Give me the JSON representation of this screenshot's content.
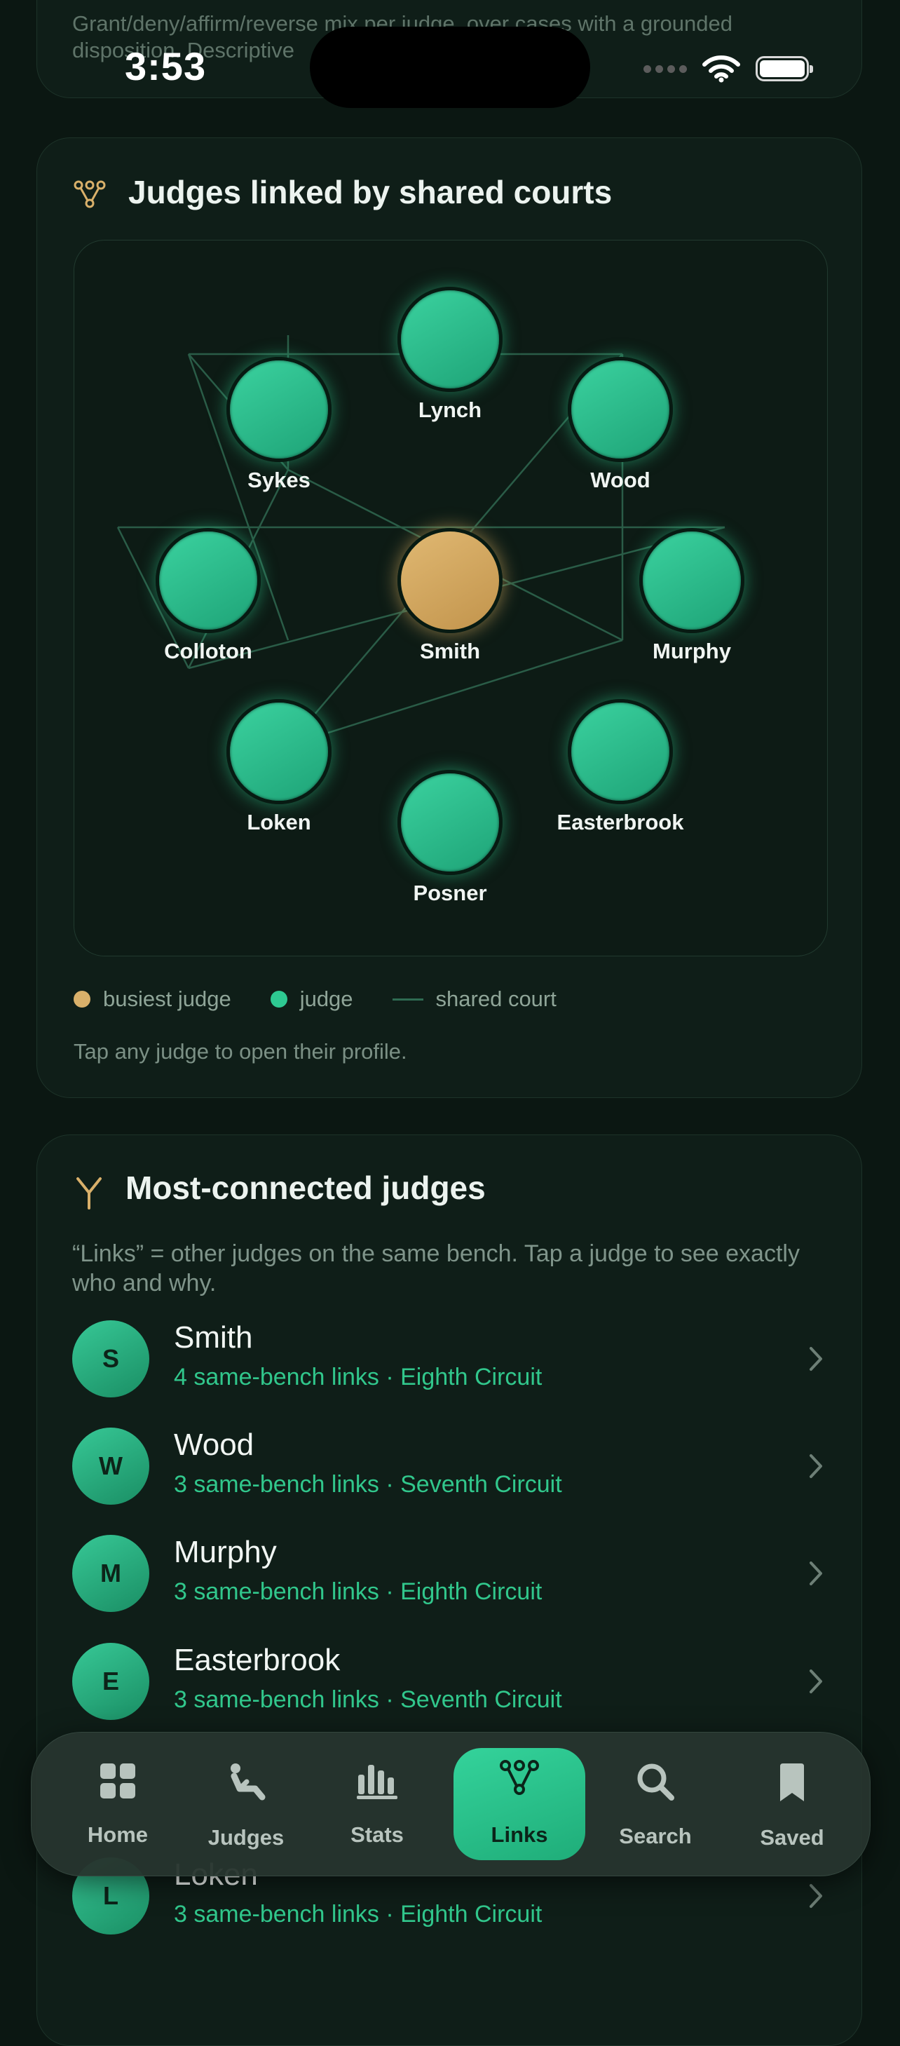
{
  "status_bar": {
    "time": "3:53"
  },
  "top_card": {
    "text": "Grant/deny/affirm/reverse mix per judge, over cases with a grounded disposition. Descriptive"
  },
  "graph_card": {
    "title": "Judges linked by shared courts",
    "nodes": [
      {
        "name": "Lynch"
      },
      {
        "name": "Sykes"
      },
      {
        "name": "Wood"
      },
      {
        "name": "Colloton"
      },
      {
        "name": "Smith"
      },
      {
        "name": "Murphy"
      },
      {
        "name": "Loken"
      },
      {
        "name": "Easterbrook"
      },
      {
        "name": "Posner"
      }
    ],
    "legend": {
      "busiest": "busiest judge",
      "judge": "judge",
      "shared": "shared court"
    },
    "hint": "Tap any judge to open their profile.",
    "colors": {
      "busiest": "#d9b06a",
      "judge": "#2ec992",
      "edge": "#2f6b52"
    }
  },
  "list_card": {
    "title": "Most-connected judges",
    "description": "“Links” = other judges on the same bench. Tap a judge to see exactly who and why.",
    "rows": [
      {
        "initial": "S",
        "name": "Smith",
        "sub": "4 same-bench links · Eighth Circuit"
      },
      {
        "initial": "W",
        "name": "Wood",
        "sub": "3 same-bench links · Seventh Circuit"
      },
      {
        "initial": "M",
        "name": "Murphy",
        "sub": "3 same-bench links · Eighth Circuit"
      },
      {
        "initial": "E",
        "name": "Easterbrook",
        "sub": "3 same-bench links · Seventh Circuit"
      },
      {
        "initial": "L",
        "name": "Loken",
        "sub": "3 same-bench links · Eighth Circuit"
      }
    ]
  },
  "tabbar": {
    "tabs": [
      {
        "label": "Home",
        "icon": "grid-icon"
      },
      {
        "label": "Judges",
        "icon": "person-icon"
      },
      {
        "label": "Stats",
        "icon": "bar-chart-icon"
      },
      {
        "label": "Links",
        "icon": "network-icon",
        "active": true
      },
      {
        "label": "Search",
        "icon": "search-icon"
      },
      {
        "label": "Saved",
        "icon": "bookmark-icon"
      }
    ]
  }
}
